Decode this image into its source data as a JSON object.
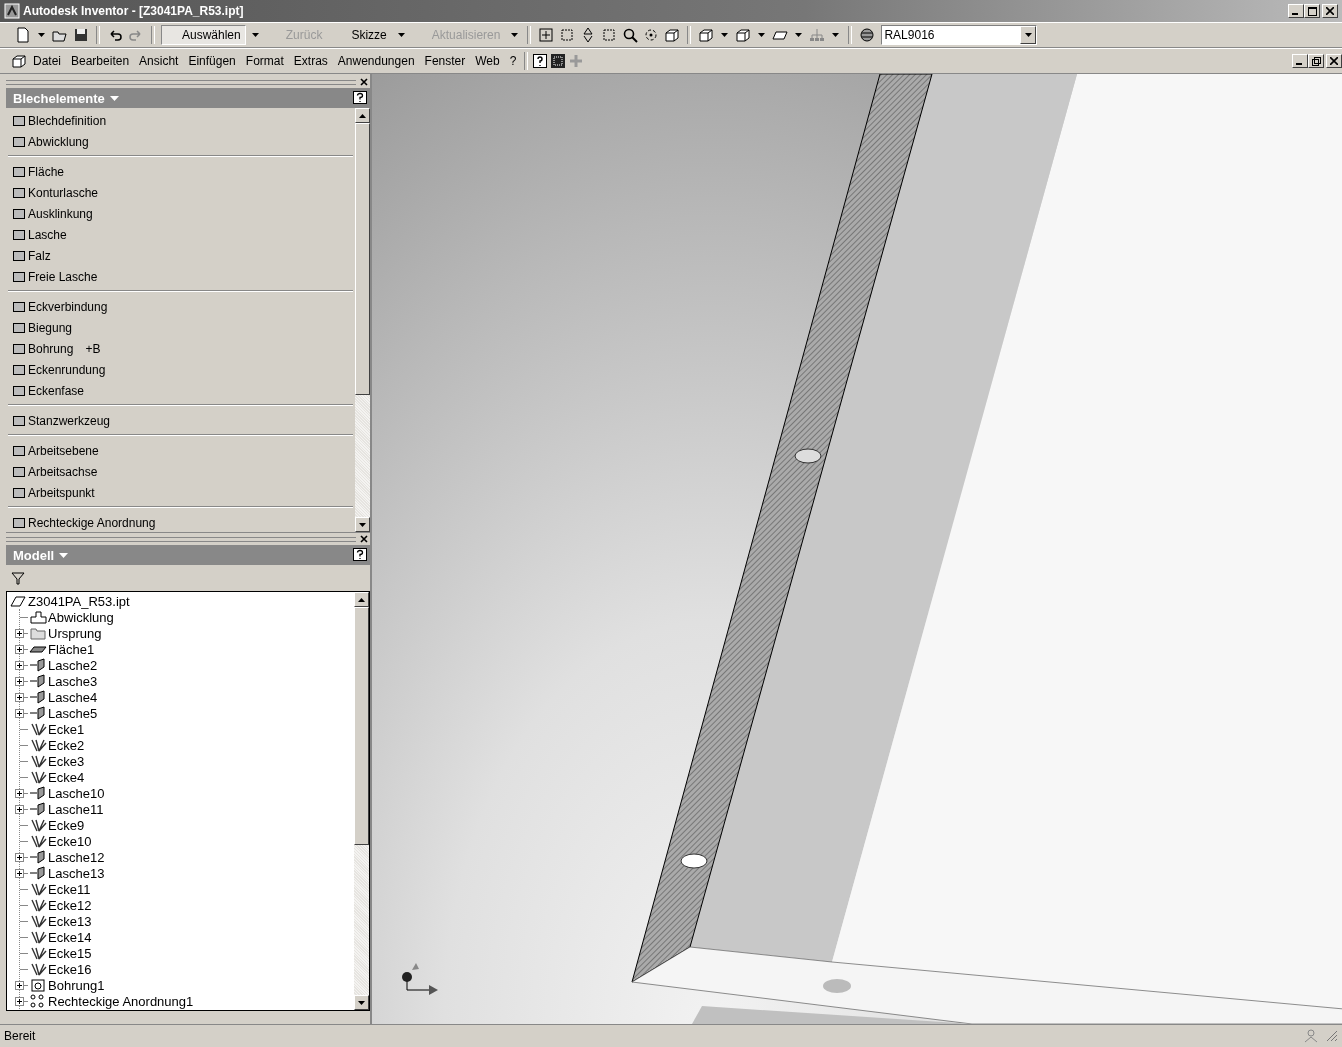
{
  "window": {
    "title": "Autodesk Inventor - [Z3041PA_R53.ipt]"
  },
  "toolbar": {
    "buttons": [
      {
        "label": "Auswählen",
        "pressed": true,
        "disabled": false
      },
      {
        "label": "Zurück",
        "pressed": false,
        "disabled": true
      },
      {
        "label": "Skizze",
        "pressed": false,
        "disabled": false
      },
      {
        "label": "Aktualisieren",
        "pressed": false,
        "disabled": true
      }
    ],
    "color_combo": {
      "value": "RAL9016"
    }
  },
  "menu": [
    "Datei",
    "Bearbeiten",
    "Ansicht",
    "Einfügen",
    "Format",
    "Extras",
    "Anwendungen",
    "Fenster",
    "Web",
    "?"
  ],
  "panel": {
    "title": "Blechelemente",
    "groups": [
      [
        {
          "label": "Blechdefinition"
        },
        {
          "label": "Abwicklung"
        }
      ],
      [
        {
          "label": "Fläche"
        },
        {
          "label": "Konturlasche"
        },
        {
          "label": "Ausklinkung"
        },
        {
          "label": "Lasche"
        },
        {
          "label": "Falz"
        },
        {
          "label": "Freie Lasche"
        }
      ],
      [
        {
          "label": "Eckverbindung"
        },
        {
          "label": "Biegung"
        },
        {
          "label": "Bohrung",
          "shortcut": "+B"
        },
        {
          "label": "Eckenrundung"
        },
        {
          "label": "Eckenfase"
        }
      ],
      [
        {
          "label": "Stanzwerkzeug"
        }
      ],
      [
        {
          "label": "Arbeitsebene"
        },
        {
          "label": "Arbeitsachse"
        },
        {
          "label": "Arbeitspunkt"
        }
      ],
      [
        {
          "label": "Rechteckige Anordnung"
        }
      ]
    ]
  },
  "model": {
    "title": "Modell",
    "tree": {
      "label": "Z3041PA_R53.ipt",
      "kind": "part",
      "children": [
        {
          "label": "Abwicklung",
          "kind": "flat",
          "expandable": false
        },
        {
          "label": "Ursprung",
          "kind": "folder",
          "expandable": true
        },
        {
          "label": "Fläche1",
          "kind": "face",
          "expandable": true
        },
        {
          "label": "Lasche2",
          "kind": "flange",
          "expandable": true
        },
        {
          "label": "Lasche3",
          "kind": "flange",
          "expandable": true
        },
        {
          "label": "Lasche4",
          "kind": "flange",
          "expandable": true
        },
        {
          "label": "Lasche5",
          "kind": "flange",
          "expandable": true
        },
        {
          "label": "Ecke1",
          "kind": "corner",
          "expandable": false
        },
        {
          "label": "Ecke2",
          "kind": "corner",
          "expandable": false
        },
        {
          "label": "Ecke3",
          "kind": "corner",
          "expandable": false
        },
        {
          "label": "Ecke4",
          "kind": "corner",
          "expandable": false
        },
        {
          "label": "Lasche10",
          "kind": "flange",
          "expandable": true
        },
        {
          "label": "Lasche11",
          "kind": "flange",
          "expandable": true
        },
        {
          "label": "Ecke9",
          "kind": "corner",
          "expandable": false
        },
        {
          "label": "Ecke10",
          "kind": "corner",
          "expandable": false
        },
        {
          "label": "Lasche12",
          "kind": "flange",
          "expandable": true
        },
        {
          "label": "Lasche13",
          "kind": "flange",
          "expandable": true
        },
        {
          "label": "Ecke11",
          "kind": "corner",
          "expandable": false
        },
        {
          "label": "Ecke12",
          "kind": "corner",
          "expandable": false
        },
        {
          "label": "Ecke13",
          "kind": "corner",
          "expandable": false
        },
        {
          "label": "Ecke14",
          "kind": "corner",
          "expandable": false
        },
        {
          "label": "Ecke15",
          "kind": "corner",
          "expandable": false
        },
        {
          "label": "Ecke16",
          "kind": "corner",
          "expandable": false
        },
        {
          "label": "Bohrung1",
          "kind": "hole",
          "expandable": true
        },
        {
          "label": "Rechteckige Anordnung1",
          "kind": "pattern",
          "expandable": true
        }
      ]
    }
  },
  "status_bar": {
    "text": "Bereit"
  }
}
